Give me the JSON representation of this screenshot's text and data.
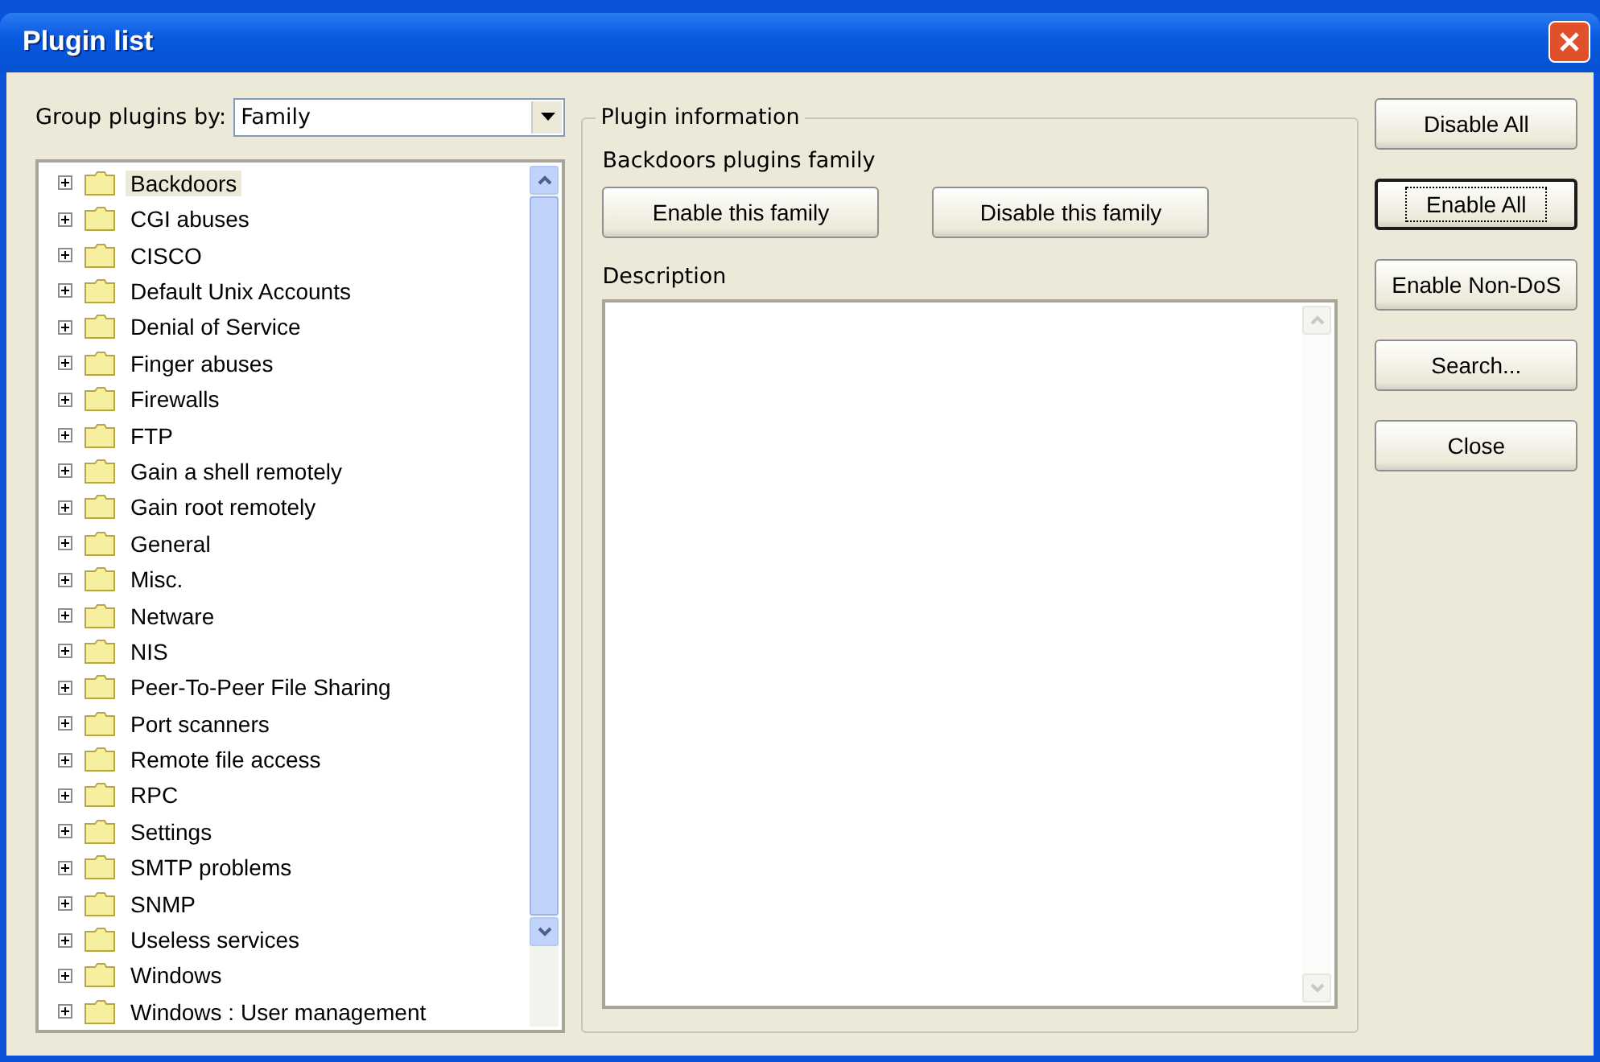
{
  "window": {
    "title": "Plugin list"
  },
  "group_by": {
    "label": "Group plugins by:",
    "value": "Family"
  },
  "tree": {
    "items": [
      {
        "label": "Backdoors",
        "selected": true
      },
      {
        "label": "CGI abuses",
        "selected": false
      },
      {
        "label": "CISCO",
        "selected": false
      },
      {
        "label": "Default Unix Accounts",
        "selected": false
      },
      {
        "label": "Denial of Service",
        "selected": false
      },
      {
        "label": "Finger abuses",
        "selected": false
      },
      {
        "label": "Firewalls",
        "selected": false
      },
      {
        "label": "FTP",
        "selected": false
      },
      {
        "label": "Gain a shell remotely",
        "selected": false
      },
      {
        "label": "Gain root remotely",
        "selected": false
      },
      {
        "label": "General",
        "selected": false
      },
      {
        "label": "Misc.",
        "selected": false
      },
      {
        "label": "Netware",
        "selected": false
      },
      {
        "label": "NIS",
        "selected": false
      },
      {
        "label": "Peer-To-Peer File Sharing",
        "selected": false
      },
      {
        "label": "Port scanners",
        "selected": false
      },
      {
        "label": "Remote file access",
        "selected": false
      },
      {
        "label": "RPC",
        "selected": false
      },
      {
        "label": "Settings",
        "selected": false
      },
      {
        "label": "SMTP problems",
        "selected": false
      },
      {
        "label": "SNMP",
        "selected": false
      },
      {
        "label": "Useless services",
        "selected": false
      },
      {
        "label": "Windows",
        "selected": false
      },
      {
        "label": "Windows : User management",
        "selected": false
      }
    ]
  },
  "plugin_information": {
    "title": "Plugin information",
    "family": "Backdoors plugins family",
    "buttons": [
      {
        "label": "Enable this family"
      },
      {
        "label": "Disable this family"
      }
    ],
    "description_label": "Description"
  },
  "side_buttons": [
    {
      "label": "Disable All",
      "focused": false
    },
    {
      "label": "Enable All",
      "focused": true
    },
    {
      "label": "Enable Non-DoS",
      "focused": false
    },
    {
      "label": "Search...",
      "focused": false
    },
    {
      "label": "Close",
      "focused": false
    }
  ]
}
